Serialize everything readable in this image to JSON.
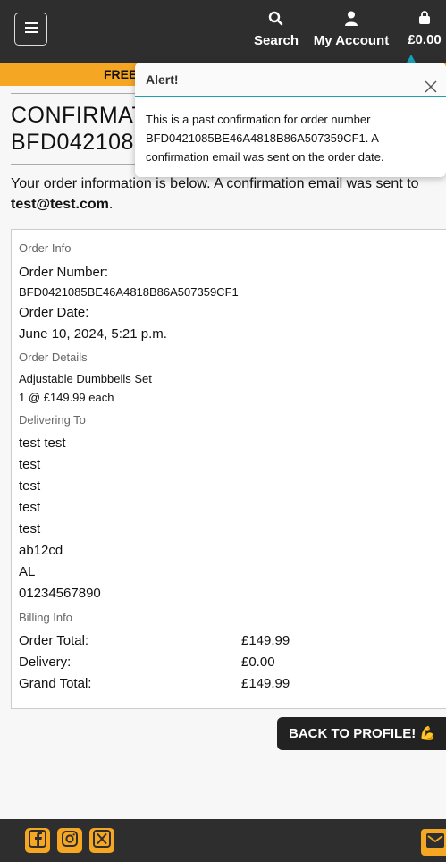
{
  "nav": {
    "search_label": "Search",
    "account_label": "My Account",
    "bag_total": "£0.00",
    "icons": [
      "menu-icon",
      "search-icon",
      "user-icon",
      "bag-icon"
    ]
  },
  "banner": {
    "text": "FREE"
  },
  "page": {
    "title": "CONFIRMAT\nBFD042108",
    "intro_text": "Your order information is below. A confirmation email was sent to",
    "email": "test@test.com",
    "intro_end": "."
  },
  "order": {
    "info_heading": "Order Info",
    "number_label": "Order Number:",
    "number_value": "BFD0421085BE46A4818B86A507359CF1",
    "date_label": "Order Date:",
    "date_value": "June 10, 2024, 5:21 p.m.",
    "details_heading": "Order Details",
    "items": [
      {
        "name": "Adjustable Dumbbells Set",
        "qty_price": "1 @ £149.99 each"
      }
    ],
    "delivering_heading": "Delivering To",
    "address_lines": [
      "test test",
      "test",
      "test",
      "test",
      "test",
      "ab12cd",
      "AL",
      "01234567890"
    ],
    "billing_heading": "Billing Info",
    "billing": [
      {
        "label": "Order Total:",
        "value": "£149.99"
      },
      {
        "label": "Delivery:",
        "value": "£0.00"
      },
      {
        "label": "Grand Total:",
        "value": "£149.99"
      }
    ]
  },
  "back_button": {
    "label": "BACK TO PROFILE! 💪"
  },
  "footer": {
    "icons": [
      "facebook-icon",
      "instagram-icon",
      "x-twitter-icon",
      "mail-icon"
    ]
  },
  "alert": {
    "title": "Alert!",
    "message": "This is a past confirmation for order number BFD0421085BE46A4818B86A507359CF1. A confirmation email was sent on the order date."
  },
  "colors": {
    "topbar": "#2e2e2e",
    "accent": "#f5a623",
    "alert_accent": "#17a2b8"
  }
}
